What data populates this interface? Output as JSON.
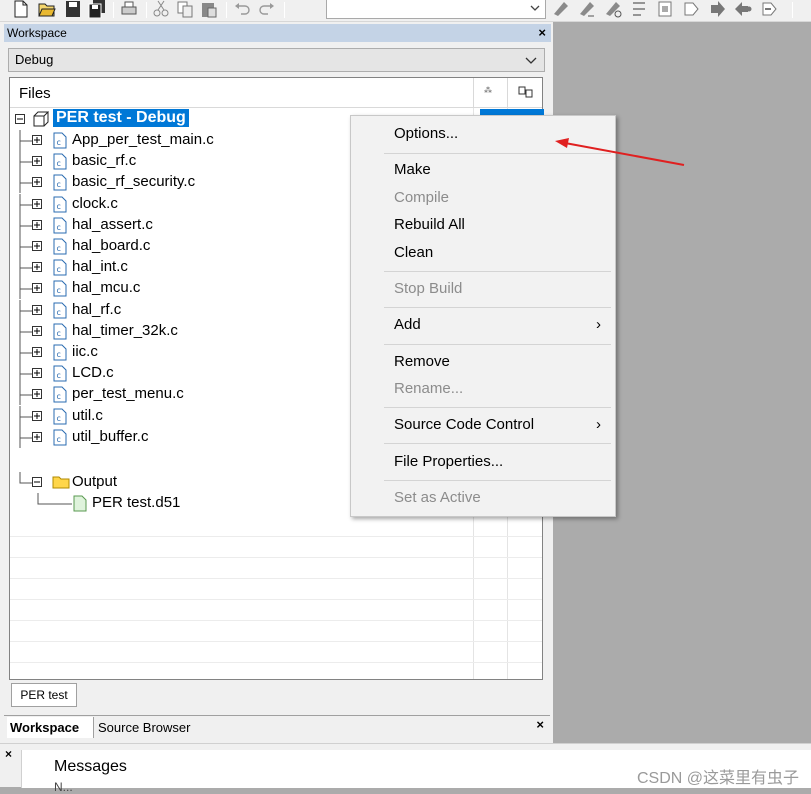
{
  "toolbar": {
    "icons_left": [
      "new-file-icon",
      "open-folder-icon",
      "save-icon",
      "save-all-icon",
      "print-icon",
      "cut-icon",
      "copy-icon",
      "paste-icon",
      "undo-icon",
      "redo-icon"
    ],
    "icons_right": [
      "toggle-bookmark-icon",
      "next-bookmark-icon",
      "find-icon",
      "replace-icon",
      "goto-icon",
      "compile-icon",
      "make-icon",
      "debug-icon",
      "stop-icon"
    ]
  },
  "workspace": {
    "title": "Workspace",
    "close": "×",
    "config": "Debug",
    "files_header": "Files",
    "root": {
      "label": "PER test - Debug"
    },
    "files": [
      "App_per_test_main.c",
      "basic_rf.c",
      "basic_rf_security.c",
      "clock.c",
      "hal_assert.c",
      "hal_board.c",
      "hal_int.c",
      "hal_mcu.c",
      "hal_rf.c",
      "hal_timer_32k.c",
      "iic.c",
      "LCD.c",
      "per_test_menu.c",
      "util.c",
      "util_buffer.c"
    ],
    "output_folder": "Output",
    "output_file": "PER test.d51",
    "project_tab": "PER test",
    "tabs": {
      "workspace": "Workspace",
      "source_browser": "Source Browser"
    },
    "tabs_close": "×"
  },
  "context_menu": {
    "options": "Options...",
    "make": "Make",
    "compile": "Compile",
    "rebuild_all": "Rebuild All",
    "clean": "Clean",
    "stop_build": "Stop Build",
    "add": "Add",
    "remove": "Remove",
    "rename": "Rename...",
    "source_code_control": "Source Code Control",
    "file_properties": "File Properties...",
    "set_as_active": "Set as Active",
    "submenu_arrow": "›"
  },
  "messages": {
    "close": "×",
    "label": "Messages",
    "line2": "N..."
  },
  "watermark": "CSDN @这菜里有虫子",
  "colors": {
    "selection": "#0078d7",
    "annotation_arrow": "#e02020",
    "title_bar": "#c4d3e6"
  }
}
